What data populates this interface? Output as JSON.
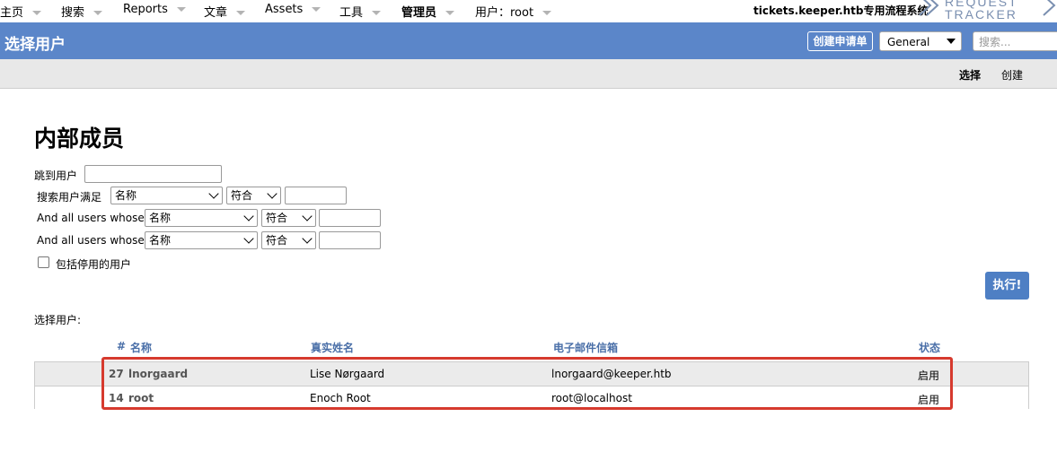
{
  "topmenu": {
    "items": [
      "主页",
      "搜索",
      "Reports",
      "文章",
      "Assets",
      "工具",
      "管理员",
      "用户：root"
    ],
    "site_name": "tickets.keeper.htb专用流程系统",
    "logo_line1": "REQUEST",
    "logo_line2": "TRACKER"
  },
  "header": {
    "title": "选择用户",
    "create_ticket_label": "创建申请单",
    "queue_selected": "General",
    "search_placeholder": "搜索...",
    "bar_color": "#5b86c9"
  },
  "pagemenu": {
    "items": [
      "选择",
      "创建"
    ]
  },
  "content": {
    "heading": "内部成员",
    "jump_label": "跳到用户",
    "criteria_label_1": "搜索用户满足",
    "criteria_label_2": "And all users whose",
    "criteria_label_3": "And all users whose",
    "field_select": "名称",
    "op_select": "符合",
    "include_disabled_label": "包括停用的用户",
    "go_label": "执行!",
    "section_label": "选择用户:"
  },
  "table": {
    "columns": [
      "#",
      "名称",
      "真实姓名",
      "电子邮件信箱",
      "状态"
    ],
    "rows": [
      {
        "id": "27",
        "name": "lnorgaard",
        "real_name": "Lise Nørgaard",
        "email": "lnorgaard@keeper.htb",
        "status": "启用"
      },
      {
        "id": "14",
        "name": "root",
        "real_name": "Enoch Root",
        "email": "root@localhost",
        "status": "启用"
      }
    ],
    "highlight_color": "#d63a2e"
  }
}
